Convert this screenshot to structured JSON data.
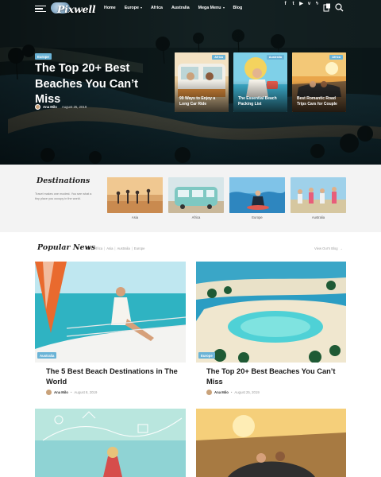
{
  "header": {
    "logo_text": "Pixwell",
    "nav": [
      {
        "label": "Home",
        "has_caret": false
      },
      {
        "label": "Europe",
        "has_caret": true
      },
      {
        "label": "Africa",
        "has_caret": false
      },
      {
        "label": "Australia",
        "has_caret": false
      },
      {
        "label": "Mega Menu",
        "has_caret": true
      },
      {
        "label": "Blog",
        "has_caret": false
      }
    ],
    "social_icons": [
      "facebook-icon",
      "twitter-icon",
      "youtube-icon",
      "vimeo-icon",
      "vk-icon"
    ],
    "social_glyphs": [
      "f",
      "t",
      "▶",
      "v",
      "ϟ"
    ],
    "cart_count": "0"
  },
  "hero": {
    "tag": "Europe",
    "title": "The Top 20+ Best Beaches You Can’t Miss",
    "author": "Ana Milo",
    "date": "August 25, 2019",
    "mini_cards": [
      {
        "tag": "Africa",
        "title": "99 Ways to Enjoy a Long Car Ride"
      },
      {
        "tag": "Australia",
        "title": "The Essential Beach Packing List"
      },
      {
        "tag": "Africa",
        "title": "Best Romantic Road Trips Cars for Couple"
      }
    ]
  },
  "destinations": {
    "heading": "Destinations",
    "text": "Travel makes one modest. You see what a tiny place you occupy in the world.",
    "items": [
      {
        "label": "Asia"
      },
      {
        "label": "Africa"
      },
      {
        "label": "Europe"
      },
      {
        "label": "Australia"
      }
    ]
  },
  "popular": {
    "heading": "Popular News",
    "filters": [
      "All",
      "Africa",
      "Asia",
      "Australia",
      "Europe"
    ],
    "view_blog": "View Our's Blog",
    "cards": [
      {
        "tag": "Australia",
        "title": "The 5 Best Beach Destinations in The World",
        "author": "Ana Milo",
        "date": "August 8, 2019"
      },
      {
        "tag": "Europe",
        "title": "The Top 20+ Best Beaches You Can’t Miss",
        "author": "Ana Milo",
        "date": "August 25, 2019"
      }
    ]
  },
  "colors": {
    "accent": "#6ab3d6",
    "section_bg": "#f3f3f3"
  }
}
